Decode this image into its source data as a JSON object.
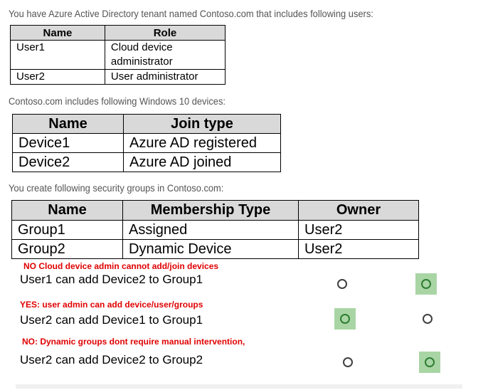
{
  "intro1": "You have Azure Active Directory tenant named Contoso.com that includes following users:",
  "users_table": {
    "headers": [
      "Name",
      "Role"
    ],
    "rows": [
      [
        "User1",
        "Cloud device administrator"
      ],
      [
        "User2",
        "User administrator"
      ]
    ]
  },
  "intro2": "Contoso.com includes following Windows 10 devices:",
  "devices_table": {
    "headers": [
      "Name",
      "Join type"
    ],
    "rows": [
      [
        "Device1",
        "Azure AD registered"
      ],
      [
        "Device2",
        "Azure AD joined"
      ]
    ]
  },
  "intro3": "You create following security groups in Contoso.com:",
  "groups_table": {
    "headers": [
      "Name",
      "Membership Type",
      "Owner"
    ],
    "rows": [
      [
        "Group1",
        "Assigned",
        "User2"
      ],
      [
        "Group2",
        "Dynamic Device",
        "User2"
      ]
    ]
  },
  "statements": [
    {
      "note": "NO Cloud device admin cannot add/join devices",
      "text": "User1 can add Device2 to Group1",
      "answer": "No"
    },
    {
      "note": "YES: user admin can add device/user/groups",
      "text": "User2 can add Device1 to Group1",
      "answer": "Yes"
    },
    {
      "note": "NO: Dynamic groups dont require manual intervention,",
      "text": "User2 can add Device2 to Group2",
      "answer": "No"
    }
  ],
  "colors": {
    "note": "#e00000",
    "selected": "#a9d5a5",
    "header_bg": "#d9d9d9"
  }
}
